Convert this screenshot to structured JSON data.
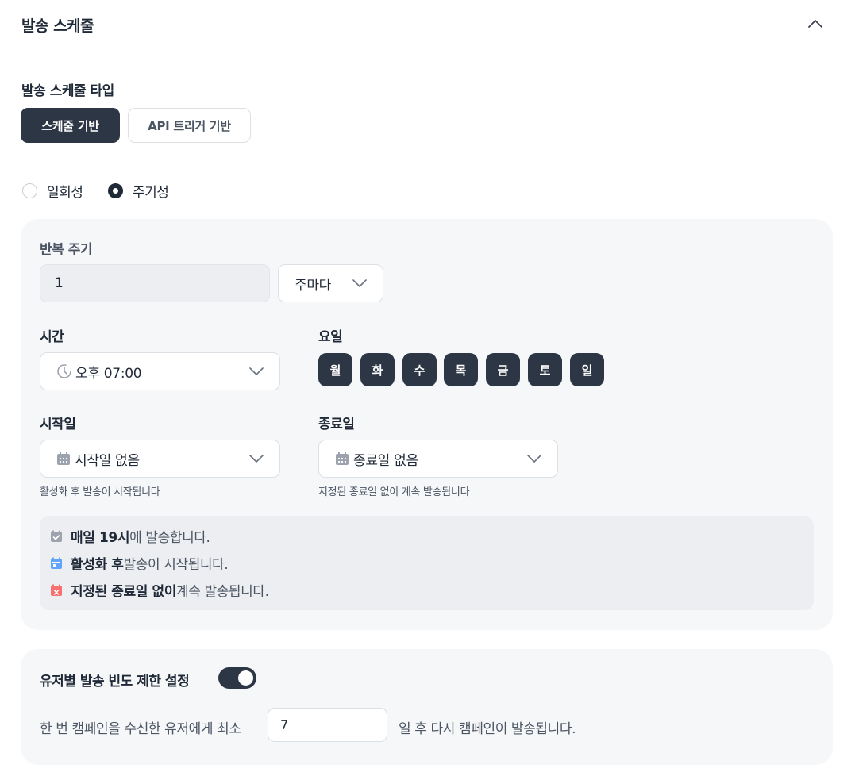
{
  "section": {
    "title": "발송 스케줄"
  },
  "schedule_type": {
    "label": "발송 스케줄 타입",
    "options": [
      "스케줄 기반",
      "API 트리거 기반"
    ],
    "selected": "스케줄 기반"
  },
  "mode": {
    "options": [
      "일회성",
      "주기성"
    ],
    "selected": "주기성"
  },
  "repeat": {
    "label": "반복 주기",
    "value": "1",
    "unit": "주마다"
  },
  "time": {
    "label": "시간",
    "value": "오후 07:00"
  },
  "days": {
    "label": "요일",
    "items": [
      "월",
      "화",
      "수",
      "목",
      "금",
      "토",
      "일"
    ]
  },
  "start_date": {
    "label": "시작일",
    "value": "시작일 없음",
    "helper": "활성화 후 발송이 시작됩니다"
  },
  "end_date": {
    "label": "종료일",
    "value": "종료일 없음",
    "helper": "지정된 종료일 없이 계속 발송됩니다"
  },
  "summary": {
    "line1": {
      "bold": "매일 19시",
      "rest": "에 발송합니다."
    },
    "line2": {
      "bold": "활성화 후",
      "rest": " 발송이 시작됩니다."
    },
    "line3": {
      "bold": "지정된 종료일 없이",
      "rest": " 계속 발송됩니다."
    }
  },
  "frequency_cap": {
    "label": "유저별 발송 빈도 제한 설정",
    "enabled": true,
    "prefix": "한 번 캠페인을 수신한 유저에게 최소",
    "value": "7",
    "suffix": "일 후 다시 캠페인이 발송됩니다."
  },
  "colors": {
    "accent_dark": "#2c3645",
    "panel_bg": "#f6f7f9",
    "icon_gray": "#9ca3af",
    "icon_blue": "#60a5fa",
    "icon_red": "#f87171"
  }
}
